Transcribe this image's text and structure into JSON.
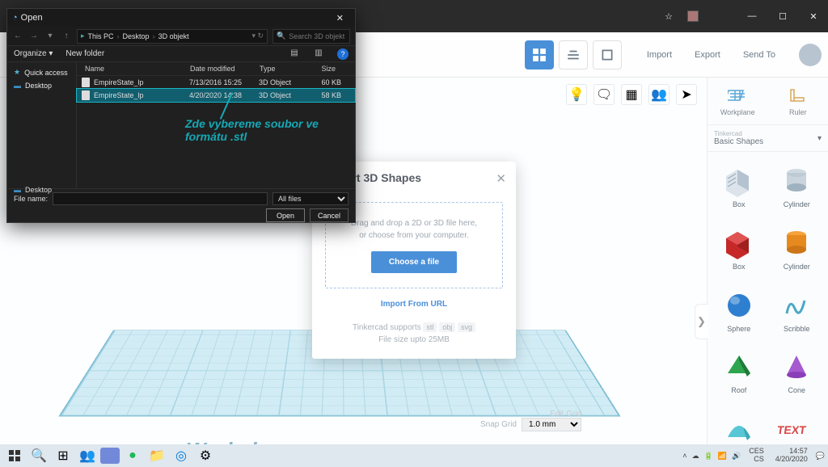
{
  "app": {
    "star": "☆",
    "min": "—",
    "max": "☐",
    "close": "✕"
  },
  "bar": {
    "import": "Import",
    "export": "Export",
    "sendto": "Send To"
  },
  "panel": {
    "workplane": "Workplane",
    "ruler": "Ruler",
    "group_small": "Tinkercad",
    "group": "Basic Shapes",
    "tab": "❯",
    "shapes": [
      "Box",
      "Cylinder",
      "Box",
      "Cylinder",
      "Sphere",
      "Scribble",
      "Roof",
      "Cone",
      "Round Roof",
      "Text"
    ]
  },
  "canvas": {
    "wp": "Workplane",
    "editgrid": "Edit Grid",
    "snap": "Snap Grid",
    "snapval": "1.0 mm"
  },
  "importModal": {
    "title": "apes",
    "drag1": "Drag and drop a 2D or 3D file here,",
    "drag2": "or choose from your computer.",
    "choose": "Choose a file",
    "url": "Import From URL",
    "supports": "Tinkercad supports",
    "f1": "stl",
    "f2": "obj",
    "f3": "svg",
    "size": "File size upto 25MB"
  },
  "dialog": {
    "title": "Open",
    "close": "✕",
    "path": [
      "This PC",
      "Desktop",
      "3D objekt"
    ],
    "search_ph": "Search 3D objekt",
    "organize": "Organize ▾",
    "newfolder": "New folder",
    "side": {
      "quick": "Quick access",
      "desktop": "Desktop",
      "desktop2": "Desktop"
    },
    "cols": {
      "name": "Name",
      "date": "Date modified",
      "type": "Type",
      "size": "Size"
    },
    "rows": [
      {
        "name": "EmpireState_lp",
        "date": "7/13/2016 15:25",
        "type": "3D Object",
        "size": "60 KB"
      },
      {
        "name": "EmpireState_lp",
        "date": "4/20/2020 14:38",
        "type": "3D Object",
        "size": "58 KB"
      }
    ],
    "annotation": "Zde vybereme soubor ve formátu .stl",
    "filename_lbl": "File name:",
    "filter": "All files",
    "open": "Open",
    "cancel": "Cancel"
  },
  "taskbar": {
    "lang1": "CES",
    "lang2": "CS",
    "time": "14:57",
    "date": "4/20/2020"
  }
}
